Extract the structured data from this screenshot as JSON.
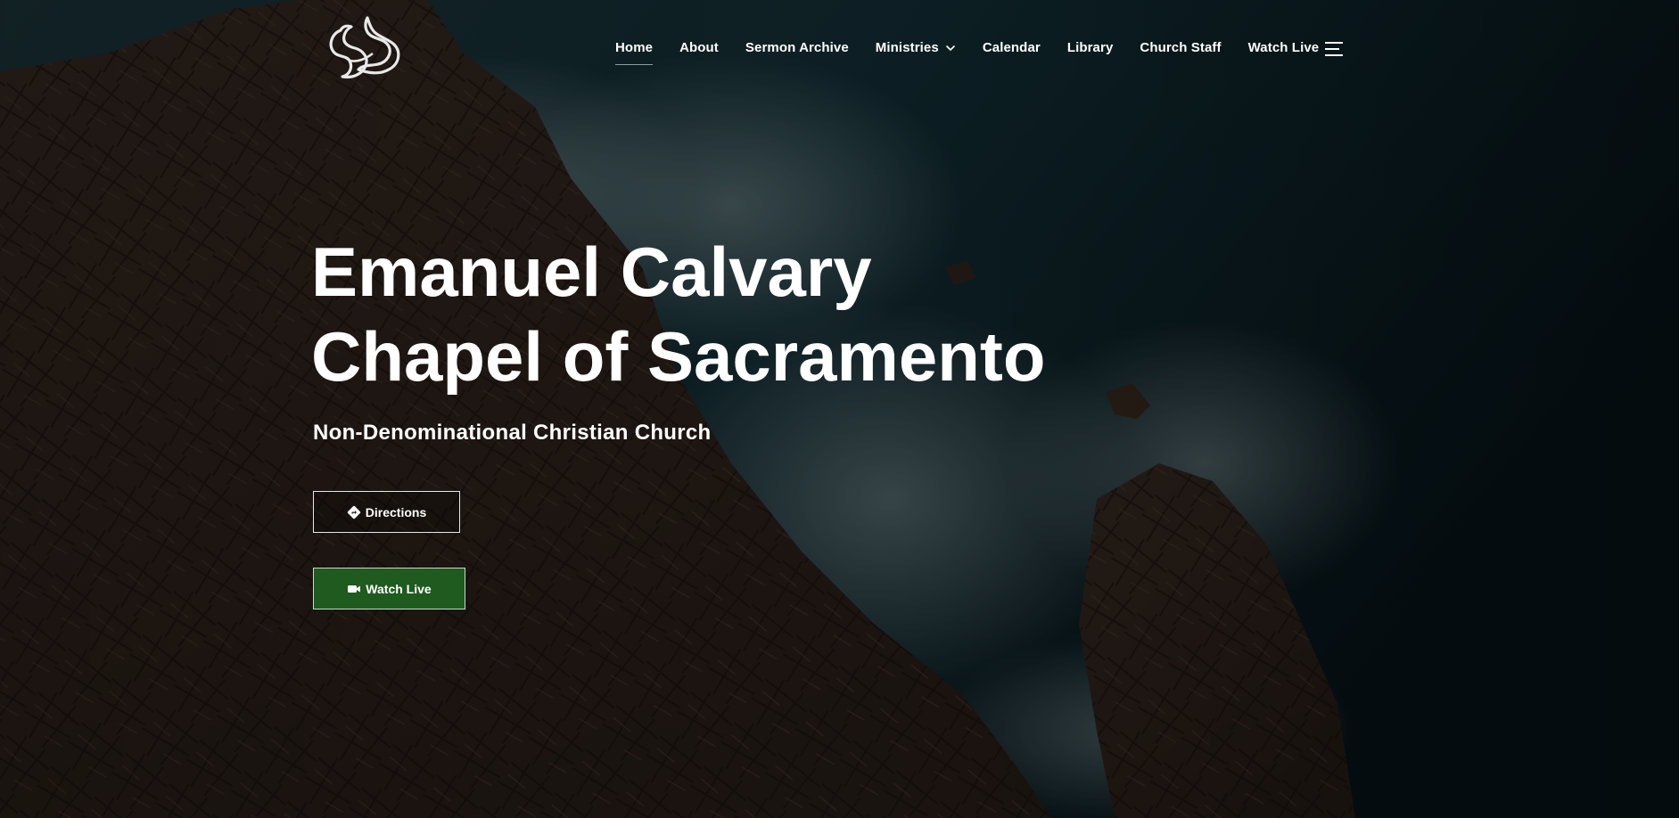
{
  "site": {
    "logo_icon": "dove-logo-icon"
  },
  "nav": {
    "items": [
      {
        "label": "Home",
        "active": true
      },
      {
        "label": "About"
      },
      {
        "label": "Sermon Archive"
      },
      {
        "label": "Ministries",
        "dropdown": true
      },
      {
        "label": "Calendar"
      },
      {
        "label": "Library"
      },
      {
        "label": "Church Staff"
      },
      {
        "label": "Watch Live"
      }
    ],
    "menu_icon": "hamburger-menu-icon"
  },
  "hero": {
    "title_line1": "Emanuel Calvary",
    "title_line2": "Chapel of Sacramento",
    "subtitle": "Non-Denominational Christian Church",
    "buttons": {
      "directions": {
        "label": "Directions",
        "icon": "directions-sign-icon"
      },
      "watch_live": {
        "label": "Watch Live",
        "icon": "video-camera-icon"
      }
    }
  },
  "colors": {
    "watch_live_button": "#1f5a1e",
    "text": "#ffffff",
    "sea": "#0e2a33",
    "rock": "#3a2a20"
  }
}
